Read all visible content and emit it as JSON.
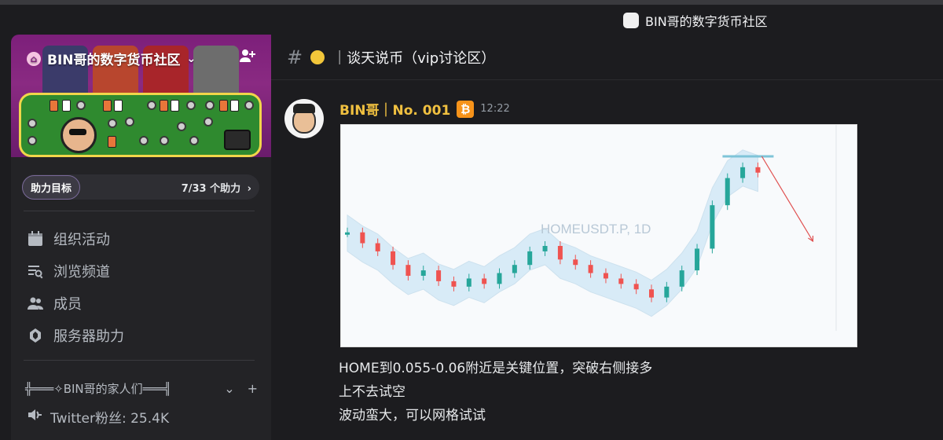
{
  "window": {
    "title": "BIN哥的数字货币社区"
  },
  "server": {
    "name": "BIN哥的数字货币社区",
    "boost": {
      "goal_label": "助力目标",
      "progress": "7/33 个助力",
      "chevron": "›"
    }
  },
  "nav": [
    {
      "label": "组织活动",
      "icon": "calendar-icon"
    },
    {
      "label": "浏览频道",
      "icon": "browse-icon"
    },
    {
      "label": "成员",
      "icon": "members-icon"
    },
    {
      "label": "服务器助力",
      "icon": "boost-icon"
    }
  ],
  "category": {
    "label": "╬═══✧BIN哥的家人们═══╣",
    "chevron": "⌄",
    "add": "+"
  },
  "channel_item": {
    "label": "Twitter粉丝: 25.4K",
    "icon": "speaker-icon"
  },
  "channel": {
    "name": "｜谈天说币（vip讨论区）"
  },
  "message": {
    "author": "BIN哥｜No. 001",
    "badge": "₿",
    "time": "12:22",
    "lines": [
      "HOME到0.055-0.06附近是关键位置，突破右侧接多",
      "上不去试空",
      "波动蛮大，可以网格试试"
    ]
  },
  "chart_data": {
    "type": "line",
    "title": "",
    "watermark": "HOMEUSDT.P, 1D",
    "series": [
      {
        "values": [
          0.62,
          0.58,
          0.55,
          0.5,
          0.46,
          0.48,
          0.44,
          0.42,
          0.45,
          0.43,
          0.47,
          0.5,
          0.55,
          0.57,
          0.52,
          0.5,
          0.47,
          0.45,
          0.43,
          0.41,
          0.38,
          0.42,
          0.48,
          0.56,
          0.72,
          0.82,
          0.86,
          0.84
        ]
      }
    ],
    "projection": "down",
    "colors": {
      "up": "#26a69a",
      "down": "#ef5350",
      "band": "#9fd0ee",
      "arrow": "#e05050",
      "level": "#7fc4d8"
    }
  }
}
